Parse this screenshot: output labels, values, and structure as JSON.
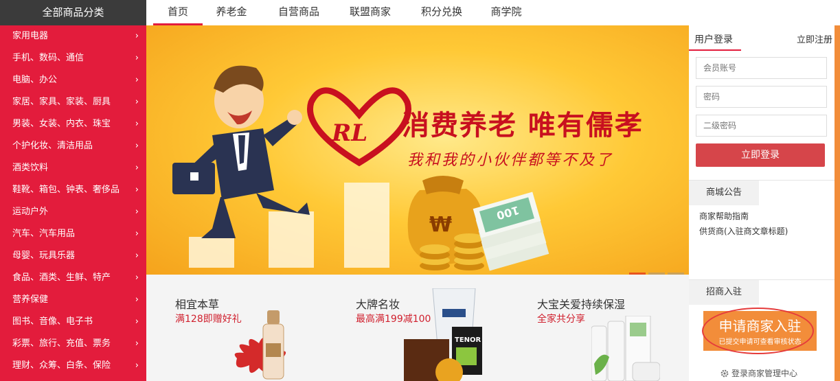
{
  "sidebar": {
    "header": "全部商品分类",
    "chevron": "›",
    "items": [
      "家用电器",
      "手机、数码、通信",
      "电脑、办公",
      "家居、家具、家装、厨具",
      "男装、女装、内衣、珠宝",
      "个护化妆、清洁用品",
      "酒类饮料",
      "鞋靴、箱包、钟表、奢侈品",
      "运动户外",
      "汽车、汽车用品",
      "母婴、玩具乐器",
      "食品、酒类、生鲜、特产",
      "营养保健",
      "图书、音像、电子书",
      "彩票、旅行、充值、票务",
      "理财、众筹、白条、保险"
    ]
  },
  "nav": {
    "tabs": [
      "首页",
      "养老金",
      "自营商品",
      "联盟商家",
      "积分兑换",
      "商学院"
    ],
    "active_index": 0
  },
  "banner": {
    "logo_text": "RL",
    "slogan": "消费养老  唯有儒孝",
    "subslogan": "我和我的小伙伴都等不及了",
    "coin_symbol": "₩",
    "bill_value": "100",
    "slide_count": 3,
    "active_slide": 0
  },
  "promos": [
    {
      "title": "相宜本草",
      "subtitle": "满128即赠好礼"
    },
    {
      "title": "大牌名妆",
      "subtitle": "最高满199减100",
      "product_label": "TENOR"
    },
    {
      "title": "大宝关爱持续保湿",
      "subtitle": "全家共分享"
    }
  ],
  "login": {
    "tab": "用户登录",
    "register": "立即注册",
    "account_placeholder": "会员账号",
    "password_placeholder": "密码",
    "second_password_placeholder": "二级密码",
    "submit": "立即登录"
  },
  "notice": {
    "tab": "商城公告",
    "items": [
      "商家帮助指南",
      "供货商(入驻商文章标题)"
    ]
  },
  "join": {
    "tab": "招商入驻",
    "apply_main": "申请商家入驻",
    "apply_sub": "已提交申请可查看审核状态",
    "manage_link": "登录商家管理中心",
    "manage_icon": "gear-icon"
  },
  "colors": {
    "sidebar_bg": "#e31c3c",
    "header_bg": "#3b3b3b",
    "accent": "#e31c3c",
    "login_button": "#d6454a",
    "apply_button": "#f28d3a"
  }
}
